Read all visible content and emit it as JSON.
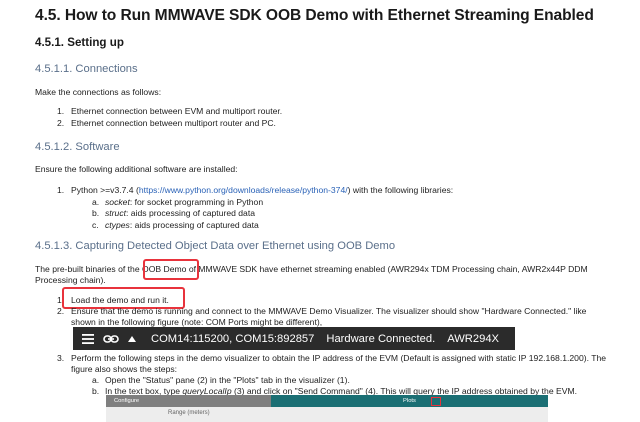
{
  "heading_main": "4.5. How to Run MMWAVE SDK OOB Demo with Ethernet Streaming Enabled",
  "heading_setup": "4.5.1. Setting up",
  "connections": {
    "title": "4.5.1.1. Connections",
    "intro": "Make the connections as follows:",
    "items": [
      "Ethernet connection between EVM and multiport router.",
      "Ethernet connection between multiport router and PC."
    ]
  },
  "software": {
    "title": "4.5.1.2. Software",
    "intro": "Ensure the following additional software are installed:",
    "python_prefix": "Python >=v3.7.4 (",
    "python_link": "https://www.python.org/downloads/release/python-374/",
    "python_suffix": ") with the following libraries:",
    "libs": [
      {
        "letter": "a.",
        "name": "socket",
        "desc": ": for socket programming in Python"
      },
      {
        "letter": "b.",
        "name": "struct",
        "desc": ": aids processing of captured data"
      },
      {
        "letter": "c.",
        "name": "ctypes",
        "desc": ": aids processing of captured data"
      }
    ]
  },
  "capturing": {
    "title": "4.5.1.3. Capturing Detected Object Data over Ethernet using OOB Demo",
    "para_line1_a": "The pre-built binaries of the ",
    "para_line1_b": "OOB Demo",
    "para_line1_c": " of MMWAVE SDK have ethernet streaming enabled (AWR294x TDM Processing chain, AWR2x44P DDM",
    "para_line2": "Processing chain).",
    "step1": "Load the demo and run it.",
    "step2_line1": "Ensure that the demo is running and connect to the MMWAVE Demo Visualizer. The visualizer should show \"Hardware Connected.\" like",
    "step2_line2": "shown in the following figure (note: COM Ports might be different),",
    "status_bar": {
      "ports": "COM14:115200, COM15:892857",
      "status": "Hardware Connected.",
      "device": "AWR294X"
    },
    "step3_line1": "Perform the following steps in the demo visualizer to obtain the IP address of the EVM (Default is assigned with static IP 192.168.1.200). The",
    "step3_line2": "figure also shows the steps:",
    "substep_a": "Open the \"Status\" pane (2) in the \"Plots\" tab in the visualizer (1).",
    "substep_b_pre": "In the text box, type ",
    "substep_b_cmd": "queryLocalIp",
    "substep_b_post": " (3) and click on \"Send Command\" (4). This will query the IP address obtained by the EVM.",
    "visualizer": {
      "tab_configure": "Configure",
      "tab_plots": "Plots",
      "range_label": "Range (meters)"
    }
  },
  "labels": {
    "n1": "1.",
    "n2": "2.",
    "n3": "3.",
    "a": "a.",
    "b": "b."
  }
}
